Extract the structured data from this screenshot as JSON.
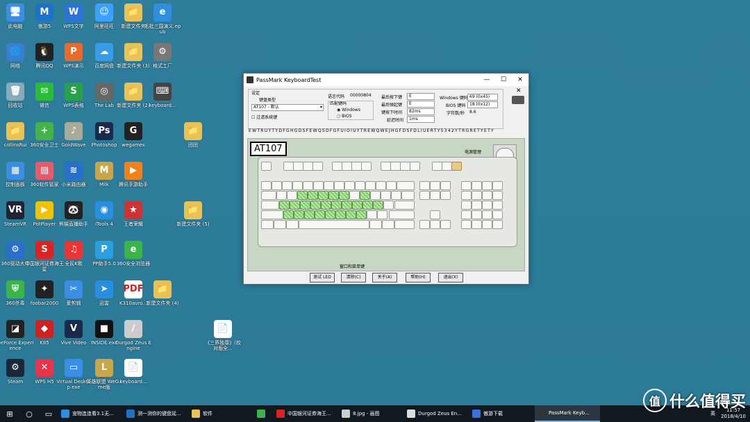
{
  "desktop_icons": [
    {
      "label": "此电脑",
      "color": "#3a8ee6",
      "glyph": "🖥"
    },
    {
      "label": "傲游5",
      "color": "#1c74c9",
      "glyph": "M"
    },
    {
      "label": "WPS文字",
      "color": "#2d72d9",
      "glyph": "W"
    },
    {
      "label": "阿里旺旺",
      "color": "#3ba0ff",
      "glyph": "☺"
    },
    {
      "label": "新建文件夹",
      "color": "#e8c157",
      "glyph": "📁"
    },
    {
      "label": "毛批三国演义.epub",
      "color": "#2f8ee0",
      "glyph": "e"
    },
    {
      "label": "网络",
      "color": "#3b7ed0",
      "glyph": "🌐"
    },
    {
      "label": "腾讯QQ",
      "color": "#222",
      "glyph": "🐧"
    },
    {
      "label": "WPS演示",
      "color": "#e86b2c",
      "glyph": "P"
    },
    {
      "label": "百度网盘",
      "color": "#3a9be6",
      "glyph": "☁"
    },
    {
      "label": "新建文件夹 (3)",
      "color": "#e8c157",
      "glyph": "📁"
    },
    {
      "label": "格式工厂",
      "color": "#777",
      "glyph": "⚙"
    },
    {
      "label": "回收站",
      "color": "#8ab",
      "glyph": "🗑"
    },
    {
      "label": "微信",
      "color": "#2dbb3a",
      "glyph": "✉"
    },
    {
      "label": "WPS表格",
      "color": "#27a24a",
      "glyph": "S"
    },
    {
      "label": "The Lab",
      "color": "#666",
      "glyph": "◎"
    },
    {
      "label": "新建文件夹 (2)",
      "color": "#e8c157",
      "glyph": "📁"
    },
    {
      "label": "keyboard...",
      "color": "#444",
      "glyph": "⌨"
    },
    {
      "label": "collinsRui",
      "color": "#e8c157",
      "glyph": "📁"
    },
    {
      "label": "360安全卫士",
      "color": "#46b24a",
      "glyph": "+"
    },
    {
      "label": "GoldWave",
      "color": "#aa9",
      "glyph": "♪"
    },
    {
      "label": "Photoshop",
      "color": "#1a2a4a",
      "glyph": "Ps"
    },
    {
      "label": "wegames",
      "color": "#222",
      "glyph": "G"
    },
    {
      "label": "团团",
      "color": "#e8c157",
      "glyph": "📁"
    },
    {
      "label": "控制面板",
      "color": "#3a8ee6",
      "glyph": "▦"
    },
    {
      "label": "360软件管家",
      "color": "#e85a6a",
      "glyph": "▤"
    },
    {
      "label": "小米路由器",
      "color": "#2a6fc9",
      "glyph": "≋"
    },
    {
      "label": "Milk",
      "color": "#c9a64a",
      "glyph": "M"
    },
    {
      "label": "腾讯手游助手",
      "color": "#f08020",
      "glyph": "▶"
    },
    {
      "label": "SteamVR",
      "color": "#223",
      "glyph": "VR"
    },
    {
      "label": "PotPlayer",
      "color": "#f2c200",
      "glyph": "▶"
    },
    {
      "label": "熊猫直播助手",
      "color": "#222",
      "glyph": "🐼"
    },
    {
      "label": "iTools 4",
      "color": "#2a8ee0",
      "glyph": "◉"
    },
    {
      "label": "王者荣耀",
      "color": "#c33",
      "glyph": "★"
    },
    {
      "label": "新建文件夹 (5)",
      "color": "#e8c157",
      "glyph": "📁"
    },
    {
      "label": "360驱动大师",
      "color": "#2a6fc9",
      "glyph": "⚙"
    },
    {
      "label": "中国银河证券海王星",
      "color": "#d22",
      "glyph": "S"
    },
    {
      "label": "全民K歌",
      "color": "#e33",
      "glyph": "♫"
    },
    {
      "label": "PP助手5.0",
      "color": "#2aa0e0",
      "glyph": "P"
    },
    {
      "label": "360安全浏览器",
      "color": "#3bb54a",
      "glyph": "e"
    },
    {
      "label": "360杀毒",
      "color": "#3bb54a",
      "glyph": "⛨"
    },
    {
      "label": "foobar2000",
      "color": "#222",
      "glyph": "✦"
    },
    {
      "label": "爱剪辑",
      "color": "#3a8ee6",
      "glyph": "✂"
    },
    {
      "label": "迅雷",
      "color": "#2a8ee0",
      "glyph": "➤"
    },
    {
      "label": "K310auro...",
      "color": "#fff",
      "glyph": "PDF"
    },
    {
      "label": "新建文件夹 (4)",
      "color": "#e8c157",
      "glyph": "📁"
    },
    {
      "label": "GeForce Experience",
      "color": "#222",
      "glyph": "◪"
    },
    {
      "label": "K85",
      "color": "#c22",
      "glyph": "◆"
    },
    {
      "label": "Vive Video",
      "color": "#1a2a4a",
      "glyph": "V"
    },
    {
      "label": "INSIDE.exe",
      "color": "#111",
      "glyph": "■"
    },
    {
      "label": "Durgod Zeus Engine",
      "color": "#ccc",
      "glyph": "/"
    },
    {
      "label": "《三界独尊》(校对版全...",
      "color": "#fff",
      "glyph": "📄"
    },
    {
      "label": "Steam",
      "color": "#1b2838",
      "glyph": "⚙"
    },
    {
      "label": "WPS H5",
      "color": "#e8344a",
      "glyph": "✕"
    },
    {
      "label": "Virtual Desktop.exe",
      "color": "#3a8ee6",
      "glyph": "▭"
    },
    {
      "label": "英雄联盟 WeGame版",
      "color": "#c9a64a",
      "glyph": "L"
    },
    {
      "label": "keyboard...",
      "color": "#fff",
      "glyph": "📄"
    }
  ],
  "window": {
    "title": "PassMark KeyboardTest",
    "settings_label": "设定",
    "kb_type_label": "键盘类型",
    "kb_type_value": "AT107 - 默认",
    "filter_label": "过滤系统键",
    "lang_code_label": "语言代码",
    "lang_code_value": "00000804",
    "match_label": "匹配键码",
    "radio_windows": "Windows",
    "radio_bios": "BIOS",
    "last_down_label": "最后按下键",
    "last_down_value": "E",
    "last_up_label": "最后弹起键",
    "last_up_value": "E",
    "press_time_label": "键按下时间",
    "press_time_value": "82ms",
    "delay_label": "延迟时间",
    "delay_value": "1ms",
    "win_code_label": "Windows 键码",
    "win_code_value": "69 (0x45)",
    "bios_code_label": "BIOS 键码",
    "bios_code_value": "18 (0x12)",
    "cps_label": "字符数/秒",
    "cps_value": "8.6",
    "typed_chars": "EWTRUYTYDFGHGDSFEWQSDFGFUIOIUYTREWQWEJHGFDSFDLIUERTY5342YTRGRETYETY",
    "model": "AT107",
    "power_label": "电源管理",
    "win_keys_label": "窗口和菜单键",
    "buttons": {
      "led": "测试 LED",
      "clear": "清除(C)",
      "about": "关于(A)",
      "help": "帮助(H)",
      "exit": "退出(X)"
    }
  },
  "taskbar": {
    "items": [
      {
        "label": "宠物连连看3.1无...",
        "color": "#2a8ee0"
      },
      {
        "label": "测一测你的键盘延...",
        "color": "#1c74c9"
      },
      {
        "label": "软件",
        "color": "#e8c157"
      },
      {
        "label": "",
        "color": "#3bb54a"
      },
      {
        "label": "中国银河证券海王...",
        "color": "#d22"
      },
      {
        "label": "8.jpg - 画图",
        "color": "#ccc"
      },
      {
        "label": "Durgod Zeus En...",
        "color": "#ddd"
      },
      {
        "label": "傲游下载",
        "color": "#3b6fd9"
      },
      {
        "label": "PassMark Keyb...",
        "color": "#333"
      }
    ],
    "ime": "英",
    "time": "11:57",
    "date": "2018/4/10"
  },
  "watermark": "什么值得买"
}
